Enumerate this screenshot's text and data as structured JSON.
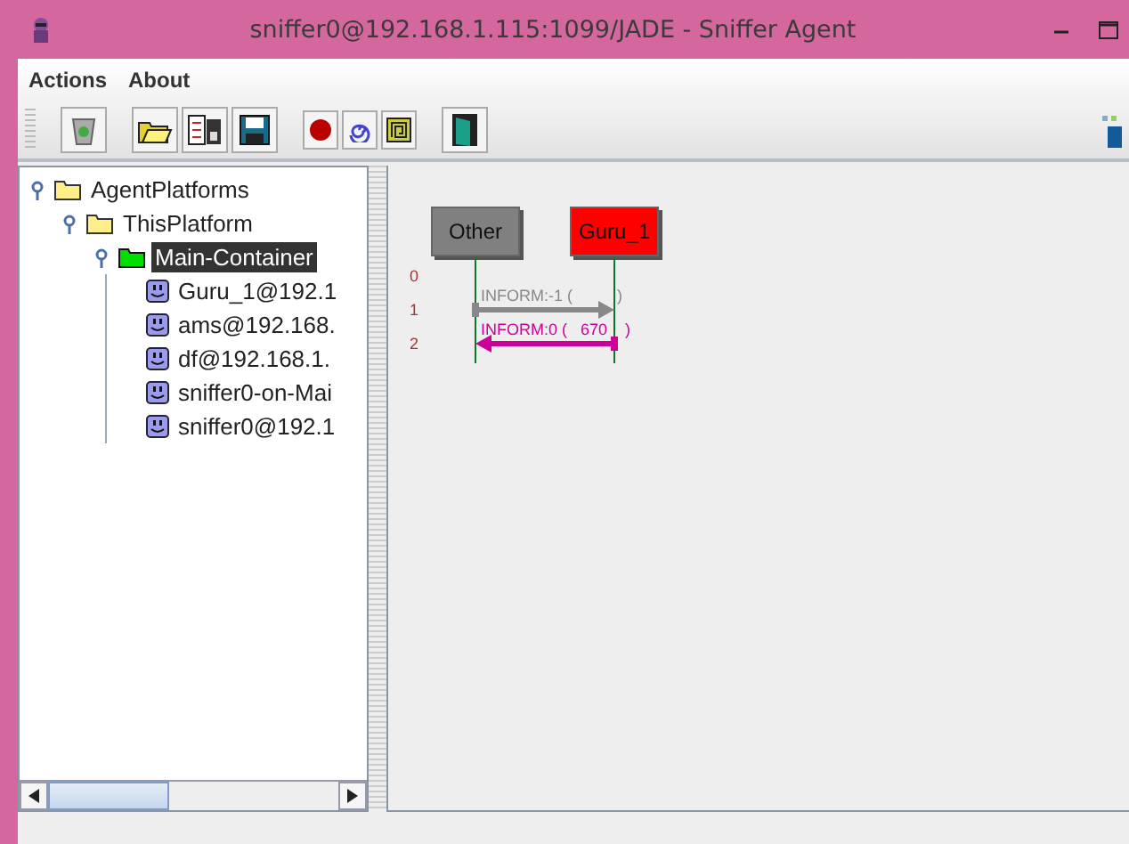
{
  "window": {
    "title": "sniffer0@192.168.1.115:1099/JADE - Sniffer Agent"
  },
  "menu": [
    "Actions",
    "About"
  ],
  "tree": [
    {
      "label": "AgentPlatforms",
      "kind": "folder",
      "selected": false,
      "children": [
        {
          "label": "ThisPlatform",
          "kind": "folder",
          "selected": false,
          "children": [
            {
              "label": "Main-Container",
              "kind": "container",
              "selected": true,
              "children": [
                {
                  "label": "Guru_1@192.1",
                  "kind": "agent",
                  "selected": false
                },
                {
                  "label": "ams@192.168.",
                  "kind": "agent",
                  "selected": false
                },
                {
                  "label": "df@192.168.1.",
                  "kind": "agent",
                  "selected": false
                },
                {
                  "label": "sniffer0-on-Mai",
                  "kind": "agent",
                  "selected": false
                },
                {
                  "label": "sniffer0@192.1",
                  "kind": "agent",
                  "selected": false
                }
              ]
            }
          ]
        }
      ]
    }
  ],
  "sniffer": {
    "agents": [
      {
        "name": "Other",
        "color": "#808080"
      },
      {
        "name": "Guru_1",
        "color": "#ff0000"
      }
    ],
    "rows": [
      "0",
      "1",
      "2"
    ],
    "messages": [
      {
        "label": "INFORM:-1 (          )",
        "kind": "forward",
        "color": "#888888"
      },
      {
        "label": "INFORM:0 (   670    )",
        "kind": "backward",
        "color": "#cc0099"
      }
    ]
  }
}
